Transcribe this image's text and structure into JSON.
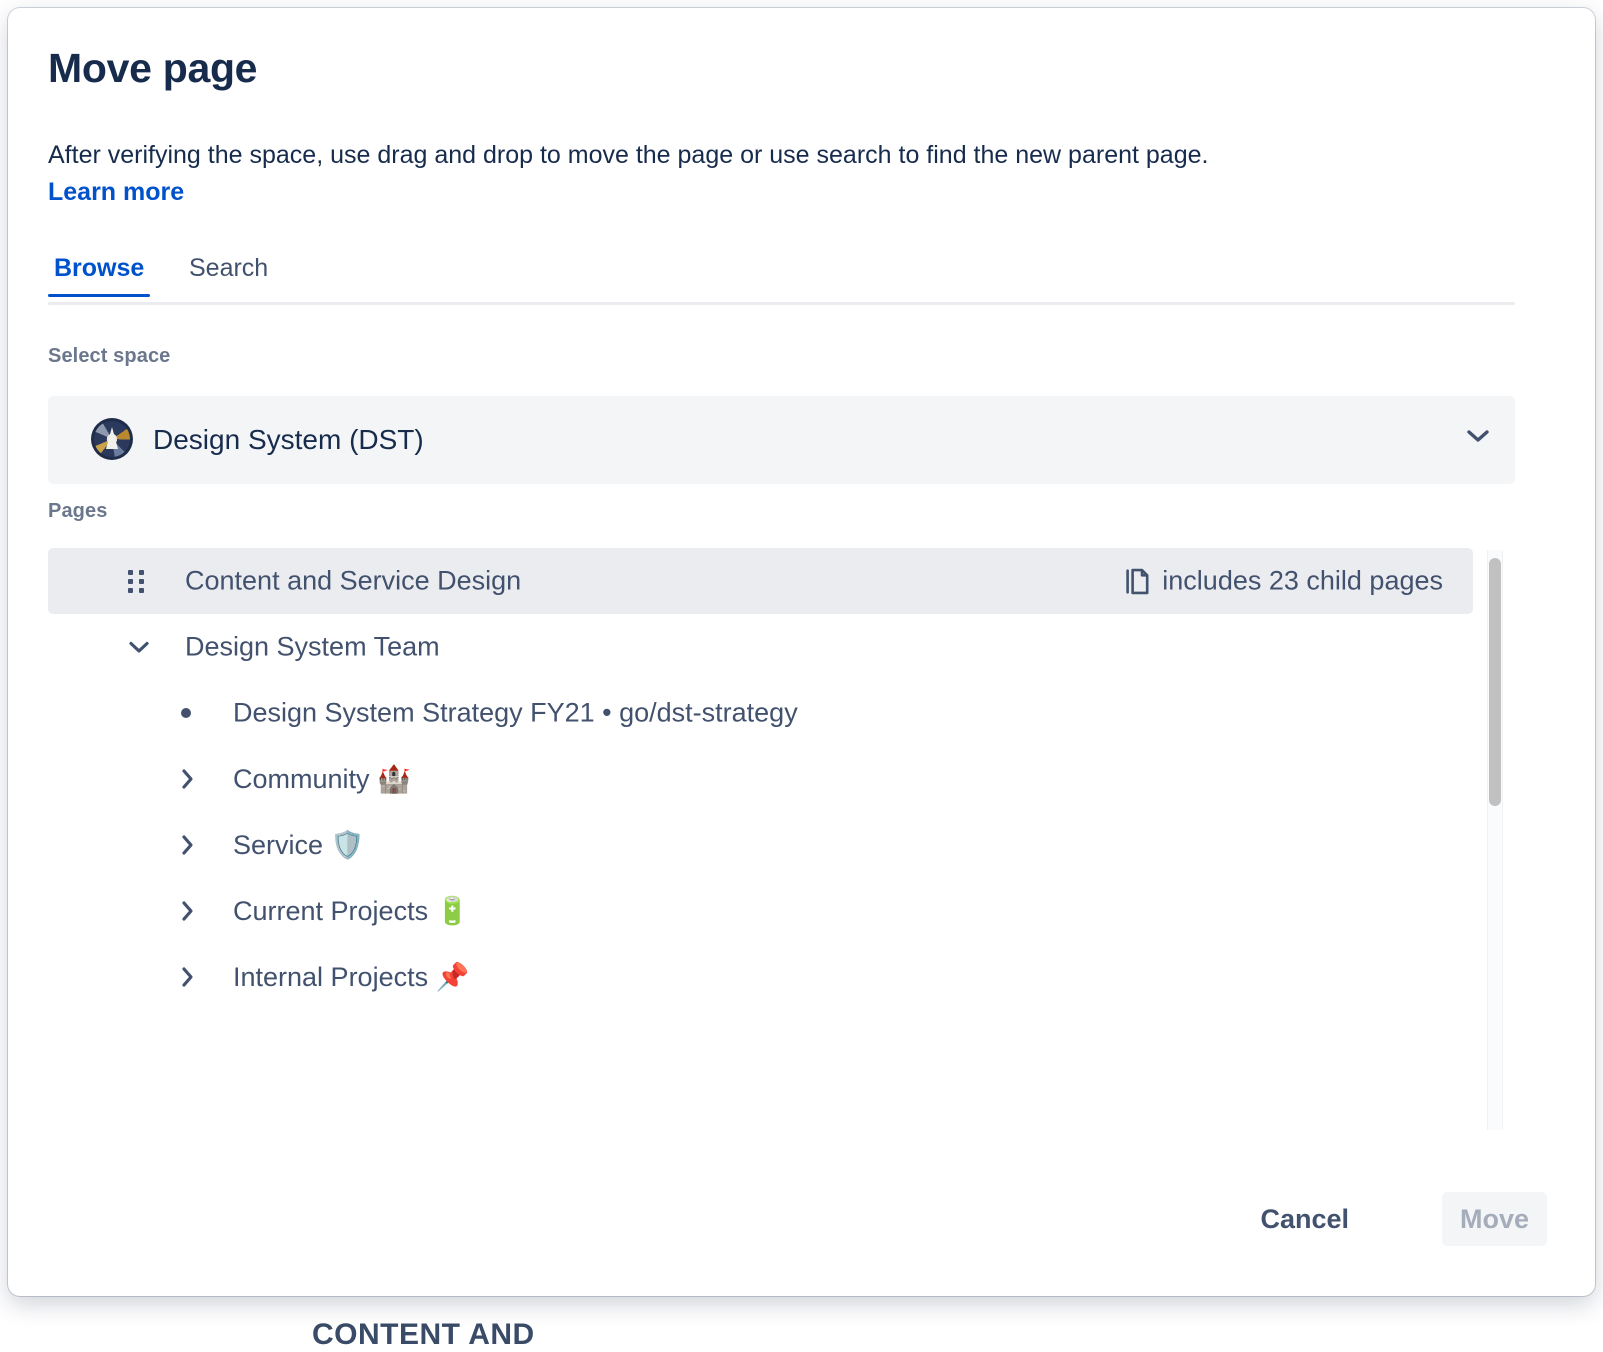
{
  "modal": {
    "title": "Move page",
    "description": "After verifying the space, use drag and drop to move the page or use search to find the new parent page.",
    "learn_more_label": "Learn more"
  },
  "tabs": [
    {
      "id": "browse",
      "label": "Browse",
      "active": true
    },
    {
      "id": "search",
      "label": "Search",
      "active": false
    }
  ],
  "select_space": {
    "label": "Select space",
    "selected_value": "Design System (DST)",
    "avatar_icon": "space-avatar-icon",
    "dropdown_icon": "chevron-down-icon"
  },
  "pages": {
    "label": "Pages",
    "tree": [
      {
        "label": "Content and Service Design",
        "depth": 0,
        "selected": true,
        "control": "drag-handle",
        "child_pages_text": "includes 23 child pages",
        "child_pages_count": 23,
        "child_pages_icon": "copy-pages-icon"
      },
      {
        "label": "Design System Team",
        "depth": 0,
        "selected": false,
        "control": "chevron-down"
      },
      {
        "label": "Design System Strategy FY21 • go/dst-strategy",
        "depth": 1,
        "selected": false,
        "control": "bullet"
      },
      {
        "label": "Community 🏰",
        "depth": 1,
        "selected": false,
        "control": "chevron-right"
      },
      {
        "label": "Service 🛡️",
        "depth": 1,
        "selected": false,
        "control": "chevron-right"
      },
      {
        "label": "Current Projects 🔋",
        "depth": 1,
        "selected": false,
        "control": "chevron-right"
      },
      {
        "label": "Internal Projects 📌",
        "depth": 1,
        "selected": false,
        "control": "chevron-right"
      }
    ]
  },
  "footer": {
    "cancel_label": "Cancel",
    "move_label": "Move",
    "move_disabled": true
  },
  "background": {
    "clipped_text": "CONTENT AND"
  },
  "colors": {
    "accent": "#0052CC",
    "text_primary": "#172B4D",
    "text_secondary": "#42526E",
    "label_muted": "#6B778C",
    "row_selected_bg": "#EBECF0",
    "field_bg": "#F4F5F7",
    "disabled_text": "#A5ADBA",
    "scrollbar_thumb": "#C1C1C1"
  }
}
